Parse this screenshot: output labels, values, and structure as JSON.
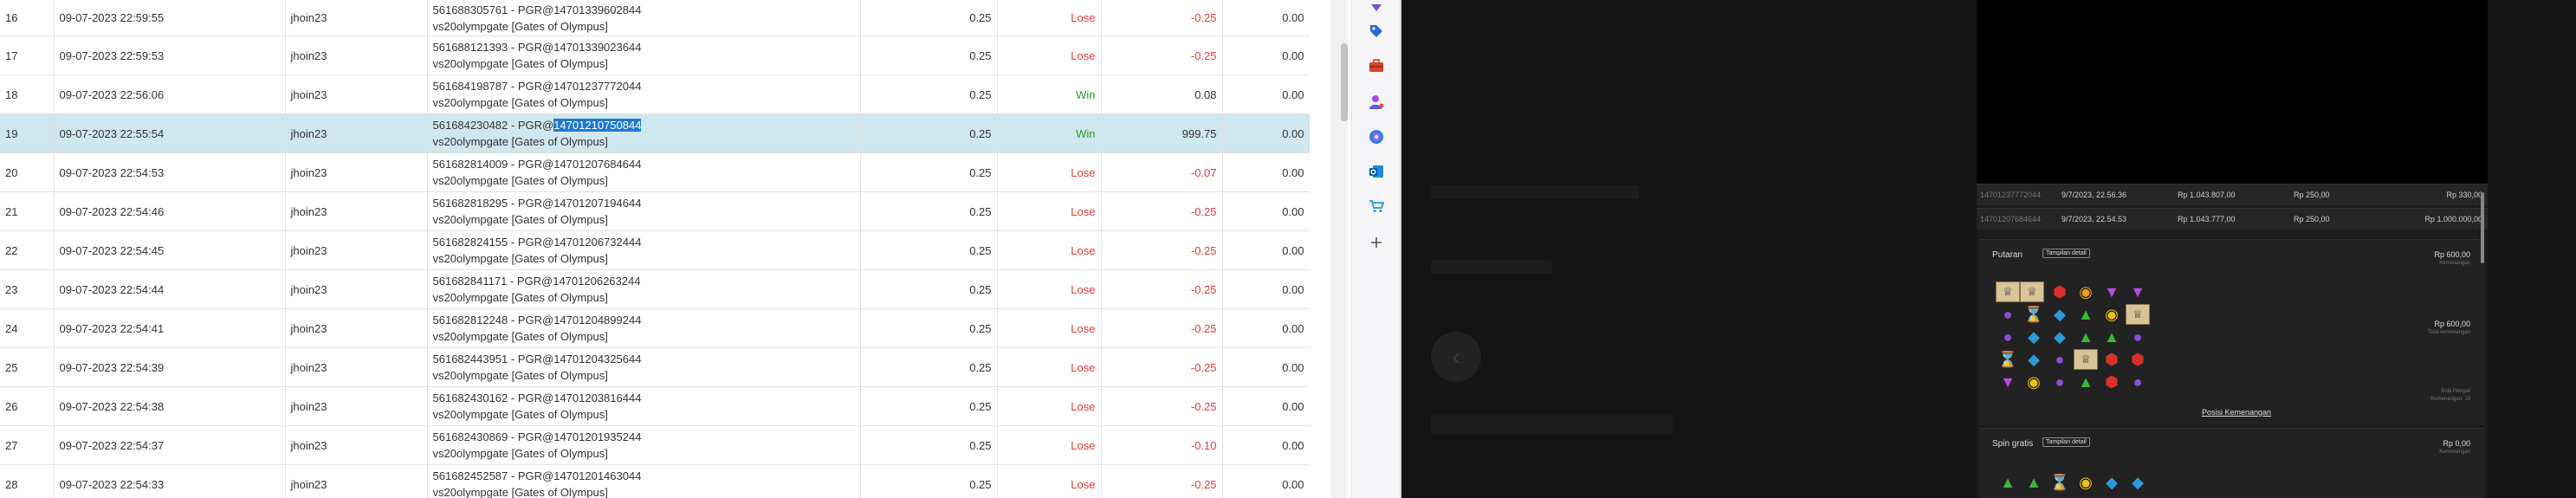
{
  "table": {
    "rows": [
      {
        "no": "16",
        "date": "09-07-2023 22:59:55",
        "user": "jhoin23",
        "ref_id": "561688305761",
        "ref_pgr": "14701339602844",
        "ref_game": "vs20olympgate [Gates of Olympus]",
        "stake": "0.25",
        "result": "Lose",
        "amount": "-0.25",
        "balance": "0.00"
      },
      {
        "no": "17",
        "date": "09-07-2023 22:59:53",
        "user": "jhoin23",
        "ref_id": "561688121393",
        "ref_pgr": "14701339023644",
        "ref_game": "vs20olympgate [Gates of Olympus]",
        "stake": "0.25",
        "result": "Lose",
        "amount": "-0.25",
        "balance": "0.00"
      },
      {
        "no": "18",
        "date": "09-07-2023 22:56:06",
        "user": "jhoin23",
        "ref_id": "561684198787",
        "ref_pgr": "14701237772044",
        "ref_game": "vs20olympgate [Gates of Olympus]",
        "stake": "0.25",
        "result": "Win",
        "amount": "0.08",
        "balance": "0.00"
      },
      {
        "no": "19",
        "date": "09-07-2023 22:55:54",
        "user": "jhoin23",
        "ref_id": "561684230482",
        "ref_pgr": "14701210750844",
        "ref_game": "vs20olympgate [Gates of Olympus]",
        "stake": "0.25",
        "result": "Win",
        "amount": "999.75",
        "balance": "0.00"
      },
      {
        "no": "20",
        "date": "09-07-2023 22:54:53",
        "user": "jhoin23",
        "ref_id": "561682814009",
        "ref_pgr": "14701207684644",
        "ref_game": "vs20olympgate [Gates of Olympus]",
        "stake": "0.25",
        "result": "Lose",
        "amount": "-0.07",
        "balance": "0.00"
      },
      {
        "no": "21",
        "date": "09-07-2023 22:54:46",
        "user": "jhoin23",
        "ref_id": "561682818295",
        "ref_pgr": "14701207194644",
        "ref_game": "vs20olympgate [Gates of Olympus]",
        "stake": "0.25",
        "result": "Lose",
        "amount": "-0.25",
        "balance": "0.00"
      },
      {
        "no": "22",
        "date": "09-07-2023 22:54:45",
        "user": "jhoin23",
        "ref_id": "561682824155",
        "ref_pgr": "14701206732444",
        "ref_game": "vs20olympgate [Gates of Olympus]",
        "stake": "0.25",
        "result": "Lose",
        "amount": "-0.25",
        "balance": "0.00"
      },
      {
        "no": "23",
        "date": "09-07-2023 22:54:44",
        "user": "jhoin23",
        "ref_id": "561682841171",
        "ref_pgr": "14701206263244",
        "ref_game": "vs20olympgate [Gates of Olympus]",
        "stake": "0.25",
        "result": "Lose",
        "amount": "-0.25",
        "balance": "0.00"
      },
      {
        "no": "24",
        "date": "09-07-2023 22:54:41",
        "user": "jhoin23",
        "ref_id": "561682812248",
        "ref_pgr": "14701204899244",
        "ref_game": "vs20olympgate [Gates of Olympus]",
        "stake": "0.25",
        "result": "Lose",
        "amount": "-0.25",
        "balance": "0.00"
      },
      {
        "no": "25",
        "date": "09-07-2023 22:54:39",
        "user": "jhoin23",
        "ref_id": "561682443951",
        "ref_pgr": "14701204325644",
        "ref_game": "vs20olympgate [Gates of Olympus]",
        "stake": "0.25",
        "result": "Lose",
        "amount": "-0.25",
        "balance": "0.00"
      },
      {
        "no": "26",
        "date": "09-07-2023 22:54:38",
        "user": "jhoin23",
        "ref_id": "561682430162",
        "ref_pgr": "14701203816444",
        "ref_game": "vs20olympgate [Gates of Olympus]",
        "stake": "0.25",
        "result": "Lose",
        "amount": "-0.25",
        "balance": "0.00"
      },
      {
        "no": "27",
        "date": "09-07-2023 22:54:37",
        "user": "jhoin23",
        "ref_id": "561682430869",
        "ref_pgr": "14701201935244",
        "ref_game": "vs20olympgate [Gates of Olympus]",
        "stake": "0.25",
        "result": "Lose",
        "amount": "-0.10",
        "balance": "0.00"
      },
      {
        "no": "28",
        "date": "09-07-2023 22:54:33",
        "user": "jhoin23",
        "ref_id": "561682452587",
        "ref_pgr": "14701201463044",
        "ref_game": "vs20olympgate [Gates of Olympus]",
        "stake": "0.25",
        "result": "Lose",
        "amount": "-0.25",
        "balance": "0.00"
      }
    ],
    "selected_row": "19",
    "pgr_prefix": "PGR@",
    "colors": {
      "win": "#2c9a2c",
      "lose": "#e53935",
      "selection": "#cfe7ee",
      "highlight": "#1f78d1"
    }
  },
  "sidebar": {
    "icons": [
      "tag-icon",
      "toolbox-icon",
      "person-icon",
      "copilot-icon",
      "outlook-icon",
      "cart-icon",
      "plus-icon"
    ]
  },
  "game_history": {
    "rows": [
      {
        "id": "14701237772044",
        "time": "9/7/2023, 22.56.36",
        "balance": "Rp 1.043.807,00",
        "stake": "Rp 250,00",
        "win": "Rp 330,00"
      },
      {
        "id": "14701207684644",
        "time": "9/7/2023, 22.54.53",
        "balance": "Rp 1.043.777,00",
        "stake": "Rp 250,00",
        "win": "Rp 1.000.000,00"
      }
    ],
    "spin_card": {
      "title": "Putaran",
      "tag": "Tampilan detail",
      "value_top": "Rp 600,00",
      "value_top_sub": "Kemenangan",
      "value_mid": "Rp 600,00",
      "value_mid_sub": "Total kemenangan",
      "bottom_sub_1": "Bola Pengali",
      "bottom_sub_2": "Kemenangan: 19",
      "link": "Posisi Kemenangan"
    },
    "free_spin_card": {
      "title": "Spin gratis",
      "tag": "Tampilan detail",
      "value": "Rp 0,00",
      "value_sub": "Kemenangan"
    }
  }
}
